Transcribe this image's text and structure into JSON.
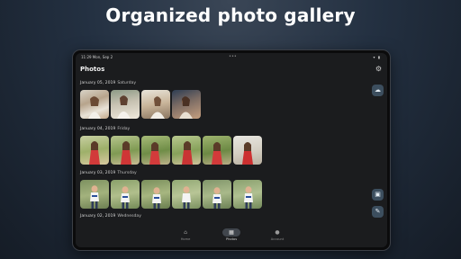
{
  "headline": "Organized photo gallery",
  "status_bar": {
    "time": "11:29  Mon, Sep 2",
    "dots": "•••",
    "icons": "▾ ▮"
  },
  "app": {
    "title": "Photos",
    "settings_icon": "gear-icon"
  },
  "groups": [
    {
      "date": "January 05, 2019",
      "day": "Saturday",
      "photo_count": 4
    },
    {
      "date": "January 04, 2019",
      "day": "Friday",
      "photo_count": 6
    },
    {
      "date": "January 03, 2019",
      "day": "Thursday",
      "photo_count": 6
    },
    {
      "date": "January 02, 2019",
      "day": "Wednesday",
      "photo_count": 0
    }
  ],
  "fabs": {
    "cloud_icon": "cloud-upload-icon",
    "gallery_icon": "image-icon",
    "edit_icon": "pencil-icon"
  },
  "nav": [
    {
      "label": "Home",
      "icon": "home-icon",
      "active": false
    },
    {
      "label": "Photos",
      "icon": "photos-icon",
      "active": true
    },
    {
      "label": "Account",
      "icon": "person-icon",
      "active": false
    }
  ],
  "colors": {
    "accent": "#3c4e5e",
    "screen_bg": "#1b1c1e"
  }
}
